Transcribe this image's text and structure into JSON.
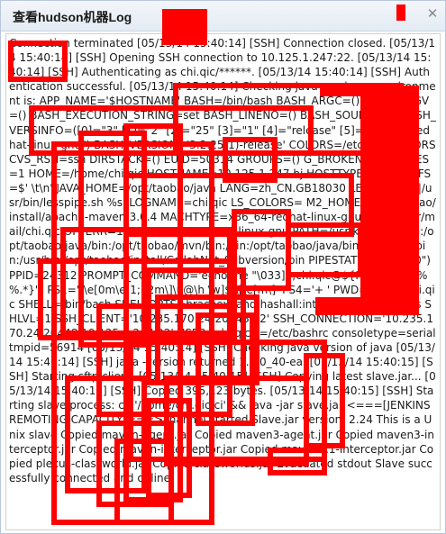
{
  "window": {
    "title": "查看hudson机器Log"
  },
  "icons": {
    "close": "✕"
  },
  "log": {
    "text": "Connection terminated [05/13/14 15:40:14] [SSH] Connection closed. [05/13/14 15:40:14] [SSH] Opening SSH connection to 10.125.1.247:22. [05/13/14 15:40:14] [SSH] Authenticating as chi.qic/******. [05/13/14 15:40:14] [SSH] Authentication successful. [05/13/14 15:40:14] Checking java version ... environment is: APP_NAME='$HOSTNAME' BASH=/bin/bash BASH_ARGC=() BASH_ARGV=() BASH_EXECUTION_STRING=set BASH_LINENO=() BASH_SOURCE=() BASH_VERSINFO=([0]=\"3\" [1]=\"2\" [2]=\"25\" [3]=\"1\" [4]=\"release\" [5]=\"x86_64-redhat-linux-gnu\") BASH_VERSION='3.2.25(1)-release' COLORS=/etc/DIR_COLORS CVS_RSH=ssh DIRSTACK=() EUID=50314 GROUPS=() G_BROKEN_FILENAMES=1 HOME=/home/chi.qic HOSTNAME=10.125.1.247.bj HOSTTYPE=x86_64 IFS=$' \\t\\n' JAVA_HOME=/opt/taobao/java LANG=zh_CN.GB18030 LESSOPEN='|/usr/bin/lesspipe.sh %s' LOGNAME=chi.qic LS_COLORS= M2_HOME=/opt/taobao/install/apache-maven-3.0.4 MACHTYPE=x86_64-redhat-linux-gnu MAIL=/var/mail/chi.qic OPTERR=1 OPTIND=1 OSTYPE=linux-gnu PATH=/usr/kerberos/bin:/opt/taobao/java/bin:/opt/taobao/mvn/bin:/bin:/opt/taobao/java/bin:/usr/local/bin:/usr/bin:/opt/taobao/install/CollabNet_Subversion/bin PIPESTATUS=([0]=\"0\") PPID=24312 PROMPT_COMMAND='echo -ne \"\\033]0;chi.qic@${HOSTNAME%%.*}\"; PS1='[\\e[0m\\e[1;32m\\]\\u@\\h \\w]$ \\[\\e[m\\]' PS4='+ ' PWD=/home/chi.qic SHELL=/bin/bash SHELLOPTS=braceexpand:hashall:interactive-comments SHLVL=1 SSH_CLIENT='10.235.170.24 20448 22' SSH_CONNECTION='10.235.170.24 20448 10.125.1.247 22' USER=chi.qic _=/etc/bashrc consoletype=serial tmpid=56914 [05/13/14 15:40:14] [SSH] Checking java version of java [05/13/14 15:40:14] [SSH] java -version returned 1.7.0_40-ea. [05/13/14 15:40:15] [SSH] Starting sftp client. [05/13/14 15:40:15] [SSH] Copying latest slave.jar... [05/13/14 15:40:15] [SSH] Copied 395,123 bytes. [05/13/14 15:40:15] [SSH] Starting slave process: cd '/home/chi.qic/ci' && java -jar slave.jar <===[JENKINS REMOTING CAPACITY]===>channel started Slave.jar version: 2.24 This is a Unix slave Copied maven-agent.jar Copied maven3-agent.jar Copied maven3-interceptor.jar Copied maven-interceptor.jar Copied maven2.1-interceptor.jar Copied plexus-classworld.jar Copied classworlds.jar Evacuated stdout Slave successfully connected and online"
  },
  "colors": {
    "redaction": "#ff0000"
  }
}
